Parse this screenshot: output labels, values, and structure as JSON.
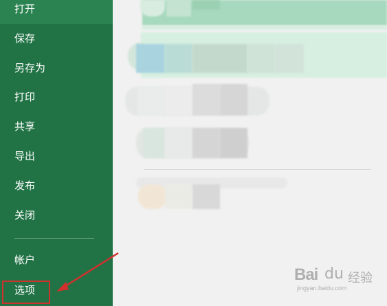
{
  "sidebar": {
    "items": [
      {
        "label": "打开"
      },
      {
        "label": "保存"
      },
      {
        "label": "另存为"
      },
      {
        "label": "打印"
      },
      {
        "label": "共享"
      },
      {
        "label": "导出"
      },
      {
        "label": "发布"
      },
      {
        "label": "关闭"
      },
      {
        "label": "帐户"
      },
      {
        "label": "选项"
      }
    ],
    "color": "#217346",
    "highlight_color": "#d0312d"
  },
  "watermark": {
    "logo": "Bai",
    "paw": "du",
    "text": "经验",
    "url": "jingyan.baidu.com"
  }
}
